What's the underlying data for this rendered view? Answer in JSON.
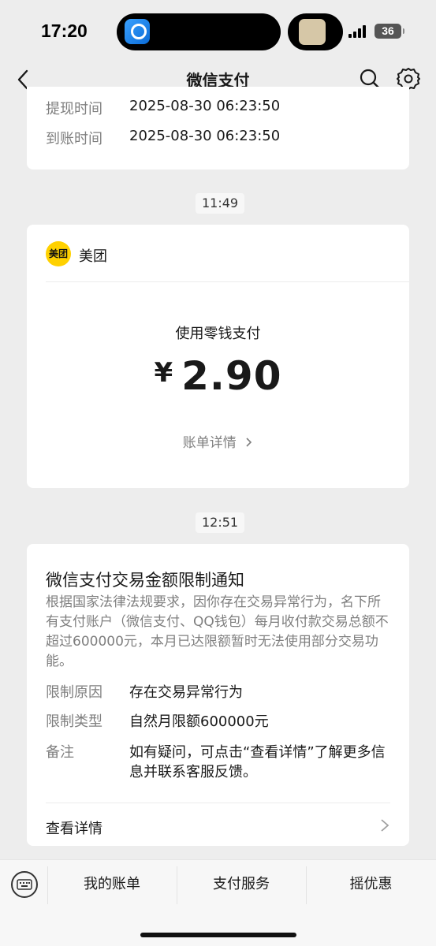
{
  "status_bar": {
    "time": "17:20",
    "battery": "36",
    "icons": [
      "railway-app-icon",
      "music-thumb-icon",
      "signal-icon",
      "battery-icon"
    ]
  },
  "nav": {
    "title": "微信支付",
    "icons": [
      "back-icon",
      "search-icon",
      "gear-icon"
    ]
  },
  "withdraw_card": {
    "rows": [
      {
        "label": "提现时间",
        "value": "2025-08-30 06:23:50"
      },
      {
        "label": "到账时间",
        "value": "2025-08-30 06:23:50"
      }
    ]
  },
  "timestamp_1": "11:49",
  "payment_card": {
    "merchant_logo_text": "美团",
    "merchant_name": "美团",
    "pay_method": "使用零钱支付",
    "currency": "¥",
    "amount": "2.90",
    "bill_link": "账单详情",
    "accent": "#ffd100"
  },
  "timestamp_2": "12:51",
  "notice_card": {
    "title": "微信支付交易金额限制通知",
    "body": "根据国家法律法规要求，因你存在交易异常行为，名下所有支付账户（微信支付、QQ钱包）每月收付款交易总额不超过600000元，本月已达限额暂时无法使用部分交易功能。",
    "rows": [
      {
        "label": "限制原因",
        "value": "存在交易异常行为"
      },
      {
        "label": "限制类型",
        "value": "自然月限额600000元"
      },
      {
        "label": "备注",
        "value": "如有疑问，可点击“查看详情”了解更多信息并联系客服反馈。"
      }
    ],
    "detail_label": "查看详情"
  },
  "bottom_bar": {
    "items": [
      "我的账单",
      "支付服务",
      "摇优惠"
    ]
  }
}
